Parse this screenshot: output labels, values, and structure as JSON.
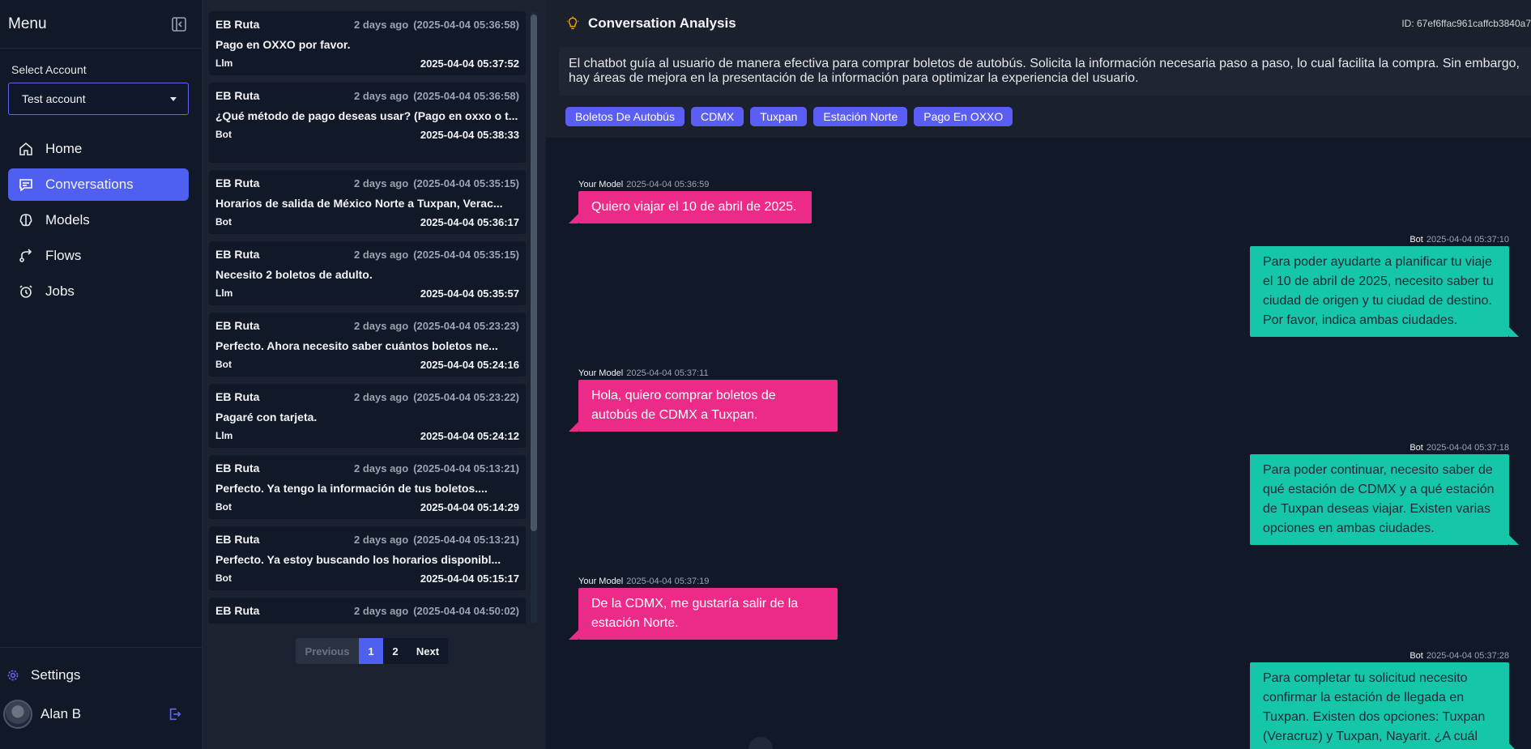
{
  "sidebar": {
    "title": "Menu",
    "account_label": "Select Account",
    "account_value": "Test account",
    "items": [
      {
        "label": "Home"
      },
      {
        "label": "Conversations"
      },
      {
        "label": "Models"
      },
      {
        "label": "Flows"
      },
      {
        "label": "Jobs"
      }
    ],
    "settings_label": "Settings",
    "user_name": "Alan B"
  },
  "conversations": [
    {
      "name": "EB Ruta",
      "rel": "2 days ago",
      "abs": "(2025-04-04 05:36:58)",
      "msg": "Pago en OXXO por favor.",
      "role": "Llm",
      "end": "2025-04-04 05:37:52"
    },
    {
      "name": "EB Ruta",
      "rel": "2 days ago",
      "abs": "(2025-04-04 05:36:58)",
      "msg": "¿Qué método de pago deseas usar? (Pago en oxxo o t...",
      "role": "Bot",
      "end": "2025-04-04 05:38:33"
    },
    {
      "name": "EB Ruta",
      "rel": "2 days ago",
      "abs": "(2025-04-04 05:35:15)",
      "msg": "Horarios de salida de México Norte a Tuxpan, Verac...",
      "role": "Bot",
      "end": "2025-04-04 05:36:17"
    },
    {
      "name": "EB Ruta",
      "rel": "2 days ago",
      "abs": "(2025-04-04 05:35:15)",
      "msg": "Necesito 2 boletos de adulto.",
      "role": "Llm",
      "end": "2025-04-04 05:35:57"
    },
    {
      "name": "EB Ruta",
      "rel": "2 days ago",
      "abs": "(2025-04-04 05:23:23)",
      "msg": "Perfecto. Ahora necesito saber cuántos boletos ne...",
      "role": "Bot",
      "end": "2025-04-04 05:24:16"
    },
    {
      "name": "EB Ruta",
      "rel": "2 days ago",
      "abs": "(2025-04-04 05:23:22)",
      "msg": "Pagaré con tarjeta.",
      "role": "Llm",
      "end": "2025-04-04 05:24:12"
    },
    {
      "name": "EB Ruta",
      "rel": "2 days ago",
      "abs": "(2025-04-04 05:13:21)",
      "msg": "Perfecto. Ya tengo la información de tus boletos....",
      "role": "Bot",
      "end": "2025-04-04 05:14:29"
    },
    {
      "name": "EB Ruta",
      "rel": "2 days ago",
      "abs": "(2025-04-04 05:13:21)",
      "msg": "Perfecto. Ya estoy buscando los horarios disponibl...",
      "role": "Bot",
      "end": "2025-04-04 05:15:17"
    },
    {
      "name": "EB Ruta",
      "rel": "2 days ago",
      "abs": "(2025-04-04 04:50:02)",
      "msg": "",
      "role": "",
      "end": ""
    }
  ],
  "pager": {
    "prev": "Previous",
    "pages": [
      "1",
      "2"
    ],
    "next": "Next"
  },
  "analysis": {
    "title": "Conversation Analysis",
    "id": "ID: 67ef6ffac961caffcb3840a7",
    "summary": "El chatbot guía al usuario de manera efectiva para comprar boletos de autobús. Solicita la información necesaria paso a paso, lo cual facilita la compra. Sin embargo, hay áreas de mejora en la presentación de la información para optimizar la experiencia del usuario.",
    "tags": [
      "Boletos De Autobús",
      "CDMX",
      "Tuxpan",
      "Estación Norte",
      "Pago En OXXO"
    ]
  },
  "messages": [
    {
      "who": "Your Model",
      "time": "2025-04-04 05:36:59",
      "text": "Quiero viajar el 10 de abril de 2025."
    },
    {
      "who": "Bot",
      "time": "2025-04-04 05:37:10",
      "text": "Para poder ayudarte a planificar tu viaje el 10 de abril de 2025, necesito saber tu ciudad de origen y tu ciudad de destino. Por favor, indica ambas ciudades."
    },
    {
      "who": "Your Model",
      "time": "2025-04-04 05:37:11",
      "text": "Hola, quiero comprar boletos de autobús de CDMX a Tuxpan."
    },
    {
      "who": "Bot",
      "time": "2025-04-04 05:37:18",
      "text": "Para poder continuar, necesito saber de qué estación de CDMX y a qué estación de Tuxpan deseas viajar. Existen varias opciones en ambas ciudades."
    },
    {
      "who": "Your Model",
      "time": "2025-04-04 05:37:19",
      "text": "De la CDMX, me gustaría salir de la estación Norte."
    },
    {
      "who": "Bot",
      "time": "2025-04-04 05:37:28",
      "text": "Para completar tu solicitud necesito confirmar la estación de llegada en Tuxpan. Existen dos opciones: Tuxpan (Veracruz) y Tuxpan, Nayarit. ¿A cuál"
    }
  ],
  "colors": {
    "accent": "#4f5ff0",
    "user_bubble": "#ec2b88",
    "bot_bubble": "#16c6a8",
    "tag": "#5b5ef5"
  }
}
